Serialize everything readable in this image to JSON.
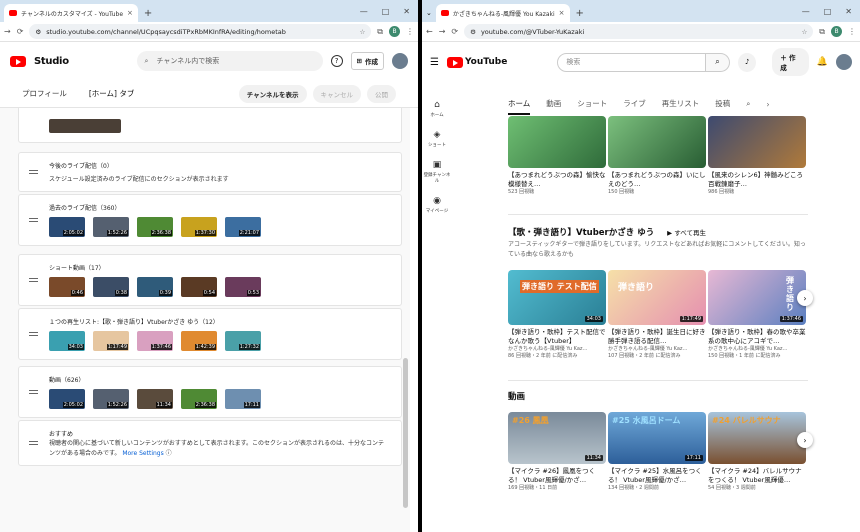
{
  "left": {
    "tab_title": "チャンネルのカスタマイズ - YouTube",
    "url": "studio.youtube.com/channel/UCpqsaycsdiTPxRbMKInfRA/editing/hometab",
    "brand": "Studio",
    "search_placeholder": "チャンネル内で検索",
    "create_label": "作成",
    "subnav": [
      "プロフィール",
      "[ホーム] タブ"
    ],
    "view_channel": "チャンネルを表示",
    "cancel": "キャンセル",
    "publish": "公開",
    "sections": {
      "upcoming": {
        "title": "今後のライブ配信（0）",
        "desc": "スケジュール設定済みのライブ配信にのセクションが表示されます"
      },
      "past_live": {
        "title": "過去のライブ配信（360）",
        "durations": [
          "2:05:02",
          "1:52:26",
          "2:36:38",
          "1:37:30",
          "2:21:07"
        ]
      },
      "shorts": {
        "title": "ショート動画（17）",
        "durations": [
          "0:46",
          "0:38",
          "0:39",
          "0:54",
          "0:53"
        ]
      },
      "playlist": {
        "title": "１つの再生リスト:【歌・弾き語り】Vtuberかざき ゆう（12）",
        "durations": [
          "34:03",
          "1:17:49",
          "1:37:46",
          "1:42:39",
          "1:27:32"
        ]
      },
      "videos": {
        "title": "動画（626）",
        "durations": [
          "2:05:02",
          "1:52:26",
          "11:34",
          "2:36:38",
          "17:11"
        ]
      },
      "recommended": {
        "title": "おすすめ",
        "desc": "視聴者の関心に基づいて新しいコンテンツがおすすめとして表示されます。このセクションが表示されるのは、十分なコンテンツがある場合のみです。",
        "link": "More Settings"
      }
    }
  },
  "right": {
    "tab_title": "かざきちゃんねる-風輝優 You Kazaki",
    "url": "youtube.com/@VTuber-YuKazaki",
    "search_placeholder": "検索",
    "create_label": "作成",
    "rail": [
      "ホーム",
      "ショート",
      "登録チャンネル",
      "マイページ"
    ],
    "channel_tabs": [
      "ホーム",
      "動画",
      "ショート",
      "ライブ",
      "再生リスト",
      "投稿"
    ],
    "row1": [
      {
        "title": "【あつまれどうぶつの森】愉快な模様替え…",
        "meta": "523 回視聴"
      },
      {
        "title": "【あつまれどうぶつの森】いにしえのどう…",
        "meta": "150 回視聴"
      },
      {
        "title": "【風来のシレン6】神髄みどころ百戦錬磨子…",
        "meta": "986 回視聴"
      }
    ],
    "playlist_section": {
      "title": "【歌・弾き語り】Vtuberかざき ゆう",
      "play_all": "すべて再生",
      "desc": "アコースティックギターで弾き語りをしています。リクエストなどあればお気軽にコメントしてください。知っている曲なら歌えるかも",
      "videos": [
        {
          "title": "【弾き語り・歌枠】テスト配信でなんか歌う【Vtuber】",
          "channel": "かざきちゃんねる-風輝優 Yu Kaz…",
          "meta": "86 回視聴・2 年前 に配信済み",
          "dur": "34:03",
          "caption": "弾き語り テスト配信"
        },
        {
          "title": "【弾き語り・歌枠】誕生日に好き勝手弾き語る配信…",
          "channel": "かざきちゃんねる-風輝優 Yu Kaz…",
          "meta": "107 回視聴・2 年前 に配信済み",
          "dur": "1:17:49",
          "caption": "弾き語り"
        },
        {
          "title": "【弾き語り・歌枠】春の歌や卒業系の歌中心にアコギで…",
          "channel": "かざきちゃんねる-風輝優 Yu Kaz…",
          "meta": "150 回視聴・1 年前 に配信済み",
          "dur": "1:37:46",
          "caption": "弾き語り"
        }
      ]
    },
    "videos_section": {
      "title": "動画",
      "videos": [
        {
          "title": "【マイクラ #26】鳳凰をつくる！ Vtuber風輝優/かざ…",
          "meta": "169 回視聴・11 日前",
          "dur": "11:34",
          "caption": "#26 鳳凰"
        },
        {
          "title": "【マイクラ #25】水風呂をつくる！ Vtuber風輝優/かざ…",
          "meta": "134 回視聴・2 週間前",
          "dur": "17:11",
          "caption": "#25 水風呂ドーム"
        },
        {
          "title": "【マイクラ #24】バレルサウナをつくる！ Vtuber風輝優…",
          "meta": "54 回視聴・3 週間前",
          "dur": "",
          "caption": "#24 バレルサウナ"
        }
      ]
    }
  }
}
